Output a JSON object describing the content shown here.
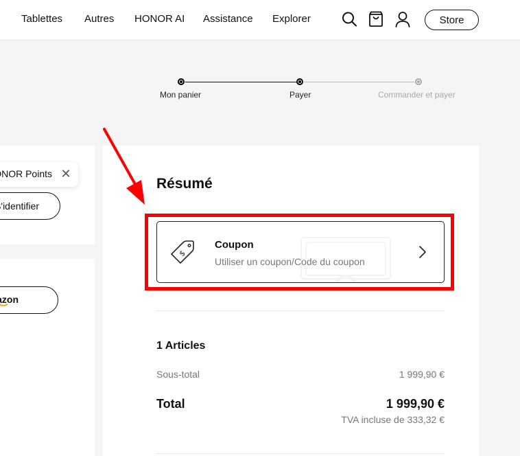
{
  "nav": {
    "items": [
      "Tablettes",
      "Autres",
      "HONOR AI",
      "Assistance",
      "Explorer"
    ],
    "store_label": "Store",
    "icons": [
      "search-icon",
      "cart-icon",
      "account-icon"
    ]
  },
  "stepper": {
    "steps": [
      "Mon panier",
      "Payer",
      "Commander et payer"
    ]
  },
  "left_panel": {
    "points_label": "HONOR Points",
    "identify_button": "S'identifier",
    "amazon_label": "amazon"
  },
  "summary": {
    "title": "Résumé",
    "coupon": {
      "title": "Coupon",
      "subtitle": "Utiliser un coupon/Code du coupon"
    },
    "articles": "1 Articles",
    "subtotal_label": "Sous-total",
    "subtotal_value": "1 999,90 €",
    "total_label": "Total",
    "total_value": "1 999,90 €",
    "vat": "TVA incluse de 333,32 €"
  },
  "colors": {
    "annotation": "#ff0000",
    "inactive_step": "#a8a8a8",
    "muted_text": "#777777"
  }
}
